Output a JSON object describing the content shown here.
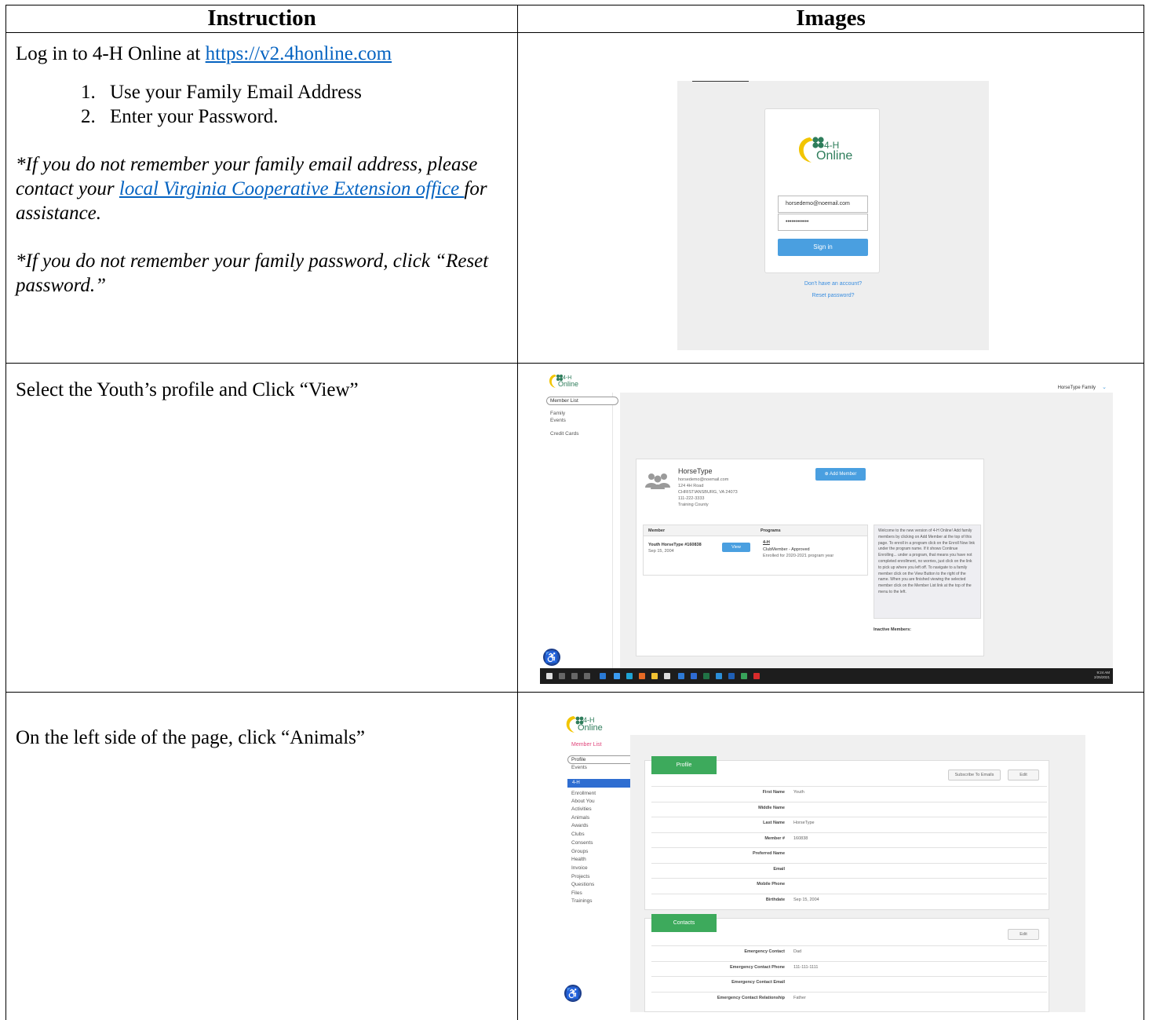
{
  "table": {
    "header_instruction": "Instruction",
    "header_images": "Images"
  },
  "row1": {
    "intro_prefix": "Log in to 4-H Online at ",
    "intro_link": "https://v2.4honline.com",
    "steps": [
      "Use your Family Email Address",
      "Enter your Password."
    ],
    "note1_prefix": "*If you do not remember your family email address, please contact your ",
    "note1_link": "local Virginia Cooperative Extension office ",
    "note1_suffix": "for assistance.",
    "note2": "*If you do not remember your family password, click “Reset password.”"
  },
  "row2": {
    "instruction": "Select the Youth’s profile and Click “View”"
  },
  "row3": {
    "instruction": "On the left side of the page, click “Animals”"
  },
  "logo": {
    "line1": "4-H",
    "line2": "Online"
  },
  "login_shot": {
    "email_value": "horsedemo@noemail.com",
    "password_value": "••••••••••••",
    "signin_label": "Sign in",
    "no_account_link": "Don't have an account?",
    "reset_link": "Reset password?"
  },
  "member_shot": {
    "user_menu": "HorseType Family",
    "sidebar": {
      "member_list": "Member List",
      "family": "Family",
      "events": "Events",
      "credit_cards": "Credit Cards"
    },
    "family": {
      "name": "HorseType",
      "email": "horsedemo@noemail.com",
      "address1": "124 4H Road",
      "address2": "CHRISTIANSBURG, VA 24073",
      "phone": "111-222-3333",
      "county": "Training County"
    },
    "add_member_label": "⊕ Add Member",
    "table": {
      "col_member": "Member",
      "col_programs": "Programs",
      "member_name": "Youth HorseType #160838",
      "member_birthdate": "Sep 15, 2004",
      "view_label": "View",
      "program_name": "4-H",
      "program_status": "ClubMember - Approved",
      "program_year": "Enrolled for 2020-2021 program year"
    },
    "welcome_text": "Welcome to the new version of 4-H Online! Add family members by clicking on Add Member at the top of this page. To enroll in a program click on the Enroll Now link under the program name. If it shows Continue Enrolling... under a program, that means you have not completed enrollment, no worries, just click on the link to pick up where you left off. To navigate to a family member click on the View Button to the right of the name. When you are finished viewing the selected member click on the Member List link at the top of the menu to the left.",
    "inactive_label": "Inactive Members:",
    "taskbar_time": "9:24 AM",
    "taskbar_date": "2/25/2021"
  },
  "profile_shot": {
    "sidebar": {
      "member_list": "Member List",
      "profile": "Profile",
      "events": "Events",
      "section_4h": "4-H",
      "items": [
        "Enrollment",
        "About You",
        "Activities",
        "Animals",
        "Awards",
        "Clubs",
        "Consents",
        "Groups",
        "Health",
        "Invoice",
        "Projects",
        "Questions",
        "Files",
        "Trainings"
      ]
    },
    "profile_tab": "Profile",
    "subscribe_label": "Subscribe To Emails",
    "edit_label": "Edit",
    "fields": [
      {
        "label": "First Name",
        "value": "Youth"
      },
      {
        "label": "Middle Name",
        "value": ""
      },
      {
        "label": "Last Name",
        "value": "HorseType"
      },
      {
        "label": "Member #",
        "value": "160838"
      },
      {
        "label": "Preferred Name",
        "value": ""
      },
      {
        "label": "Email",
        "value": ""
      },
      {
        "label": "Mobile Phone",
        "value": ""
      },
      {
        "label": "Birthdate",
        "value": "Sep 15, 2004"
      }
    ],
    "contacts_tab": "Contacts",
    "contacts_edit_label": "Edit",
    "contacts": [
      {
        "label": "Emergency Contact",
        "value": "Dad"
      },
      {
        "label": "Emergency Contact Phone",
        "value": "111-111-1111"
      },
      {
        "label": "Emergency Contact Email",
        "value": ""
      },
      {
        "label": "Emergency Contact Relationship",
        "value": "Father"
      }
    ]
  },
  "colors": {
    "link": "#0563c1",
    "primary_button": "#4a9fe0",
    "green_tab": "#3daa5c",
    "nav_active": "#2f6ed1",
    "logo_green": "#2e7d5b",
    "logo_yellow": "#f2c500"
  }
}
